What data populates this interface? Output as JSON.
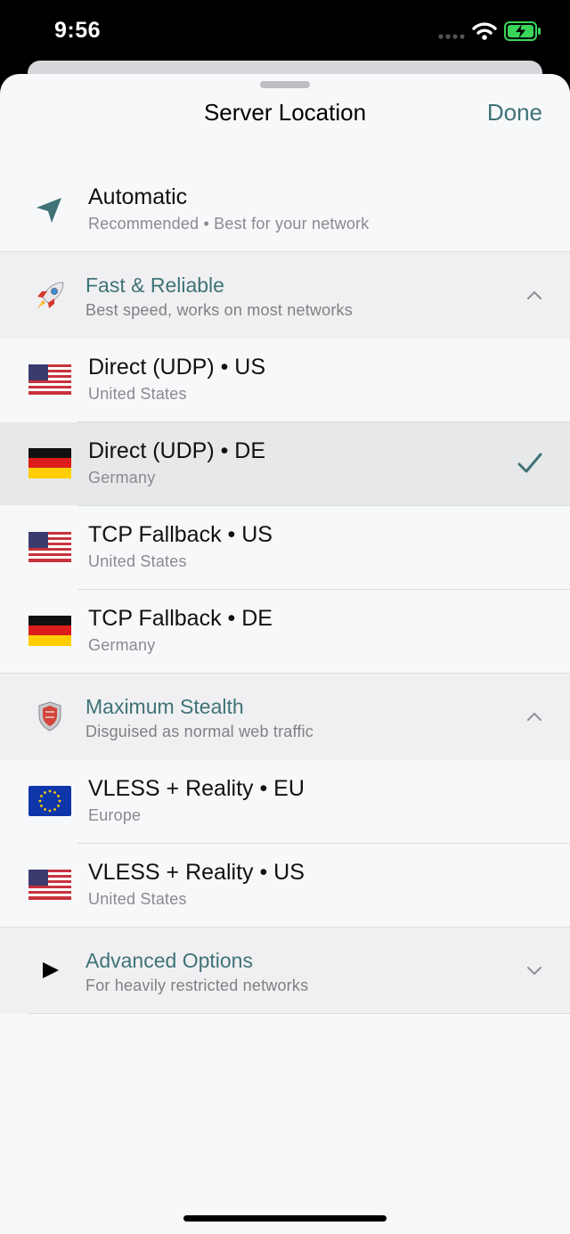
{
  "status_bar": {
    "time": "9:56"
  },
  "header": {
    "title": "Server Location",
    "done_label": "Done"
  },
  "automatic": {
    "title": "Automatic",
    "subtitle": "Recommended • Best for your network"
  },
  "sections": [
    {
      "title": "Fast & Reliable",
      "subtitle": "Best speed, works on most networks",
      "icon": "rocket-icon",
      "expanded": true
    },
    {
      "title": "Maximum Stealth",
      "subtitle": "Disguised as normal web traffic",
      "icon": "shield-icon",
      "expanded": true
    },
    {
      "title": "Advanced Options",
      "subtitle": "For heavily restricted networks",
      "icon": "play-icon",
      "expanded": false
    }
  ],
  "servers": [
    {
      "title": "Direct (UDP) • US",
      "subtitle": "United States",
      "flag": "us-flag-icon",
      "selected": false
    },
    {
      "title": "Direct (UDP) • DE",
      "subtitle": "Germany",
      "flag": "de-flag-icon",
      "selected": true
    },
    {
      "title": "TCP Fallback • US",
      "subtitle": "United States",
      "flag": "us-flag-icon",
      "selected": false
    },
    {
      "title": "TCP Fallback • DE",
      "subtitle": "Germany",
      "flag": "de-flag-icon",
      "selected": false
    },
    {
      "title": "VLESS + Reality • EU",
      "subtitle": "Europe",
      "flag": "eu-flag-icon",
      "selected": false
    },
    {
      "title": "VLESS + Reality • US",
      "subtitle": "United States",
      "flag": "us-flag-icon",
      "selected": false
    }
  ],
  "colors": {
    "accent": "#3f7377",
    "selected_row": "#e6e8e9",
    "section_bg": "#f0f0f2"
  }
}
